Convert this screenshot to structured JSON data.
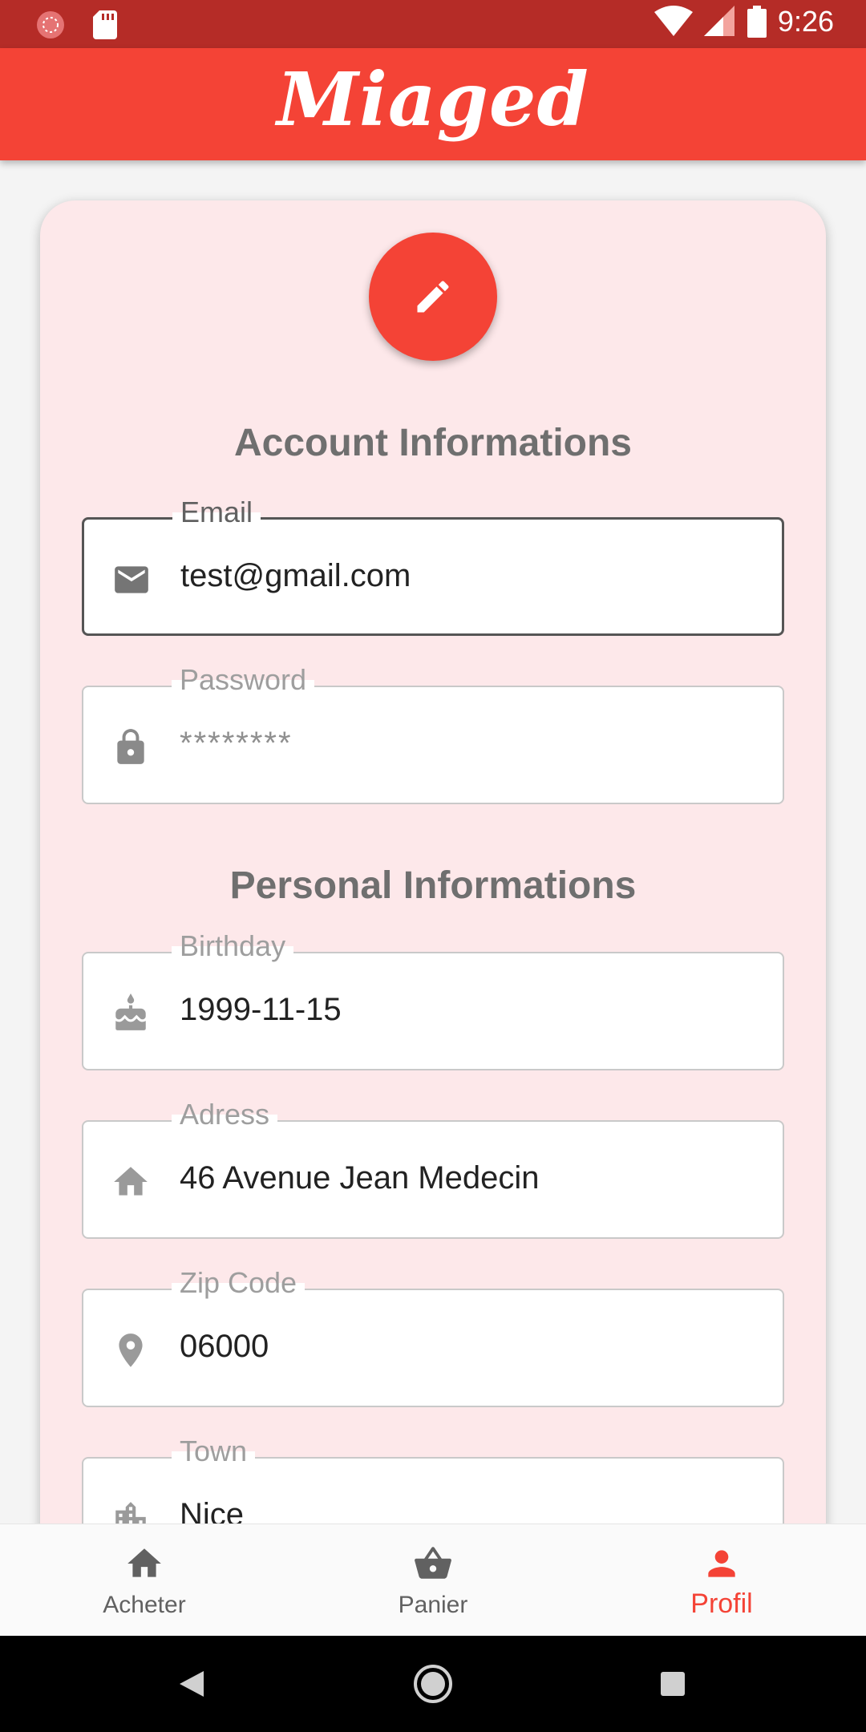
{
  "status_bar": {
    "time": "9:26"
  },
  "app_bar": {
    "title": "Miaged"
  },
  "account_section": {
    "title": "Account Informations",
    "email": {
      "label": "Email",
      "value": "test@gmail.com",
      "icon": "mail-icon"
    },
    "password": {
      "label": "Password",
      "placeholder": "********",
      "icon": "lock-icon"
    }
  },
  "personal_section": {
    "title": "Personal Informations",
    "birthday": {
      "label": "Birthday",
      "value": "1999-11-15",
      "icon": "cake-icon"
    },
    "address": {
      "label": "Adress",
      "value": "46 Avenue Jean Medecin",
      "icon": "home-icon"
    },
    "zip": {
      "label": "Zip Code",
      "value": "06000",
      "icon": "location-pin-icon"
    },
    "town": {
      "label": "Town",
      "value": "Nice",
      "icon": "city-icon"
    }
  },
  "bottom_nav": {
    "items": [
      {
        "label": "Acheter",
        "icon": "home-icon"
      },
      {
        "label": "Panier",
        "icon": "basket-icon"
      },
      {
        "label": "Profil",
        "icon": "person-icon",
        "active": true
      }
    ]
  },
  "colors": {
    "primary": "#f44336",
    "status_bar": "#b52c27",
    "card": "#fde8ea"
  }
}
